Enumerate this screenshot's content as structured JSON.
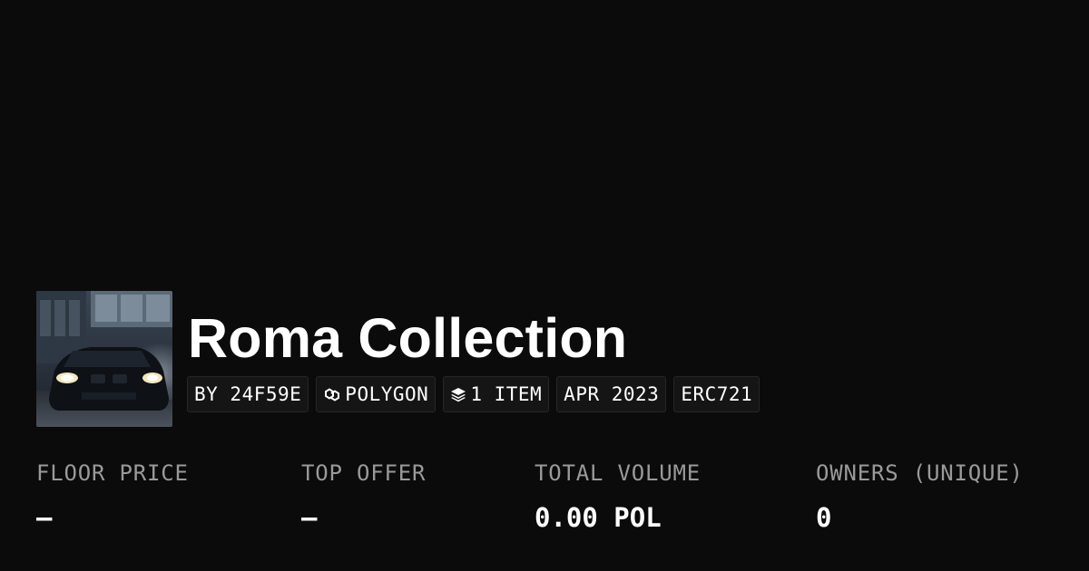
{
  "collection": {
    "name": "Roma Collection",
    "thumbnail_icon": "car-thumbnail"
  },
  "badges": [
    {
      "label": "BY 24F59E",
      "icon": ""
    },
    {
      "label": "POLYGON",
      "icon": "polygon-chain-icon"
    },
    {
      "label": "1 ITEM",
      "icon": "layers-icon"
    },
    {
      "label": "APR 2023",
      "icon": ""
    },
    {
      "label": "ERC721",
      "icon": ""
    }
  ],
  "stats": [
    {
      "label": "FLOOR PRICE",
      "value": "–"
    },
    {
      "label": "TOP OFFER",
      "value": "–"
    },
    {
      "label": "TOTAL VOLUME",
      "value": "0.00 POL"
    },
    {
      "label": "OWNERS (UNIQUE)",
      "value": "0"
    }
  ],
  "colors": {
    "background": "#0b0b0b",
    "badge_background": "#151515",
    "label_gray": "#9a9a9a",
    "text": "#ffffff"
  }
}
